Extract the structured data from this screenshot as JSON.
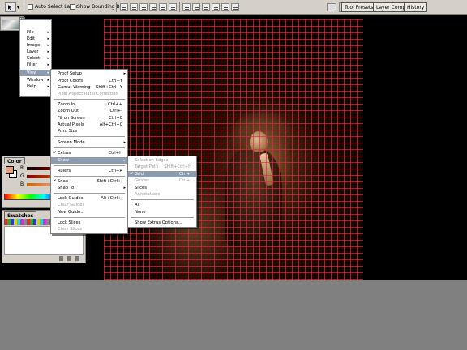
{
  "options_bar": {
    "auto_select_label": "Auto Select Layer",
    "bounding_box_label": "Show Bounding Box",
    "tabs": [
      "Tool Presets",
      "Layer Comps",
      "History"
    ]
  },
  "main_menu": {
    "items": [
      "File",
      "Edit",
      "Image",
      "Layer",
      "Select",
      "Filter",
      "View",
      "Window",
      "Help"
    ],
    "active": "View"
  },
  "view_menu": {
    "proof_setup": "Proof Setup",
    "proof_colors": "Proof Colors",
    "proof_colors_sc": "Ctrl+Y",
    "gamut_warning": "Gamut Warning",
    "gamut_warning_sc": "Shift+Ctrl+Y",
    "pixel_aspect": "Pixel Aspect Ratio Correction",
    "zoom_in": "Zoom In",
    "zoom_in_sc": "Ctrl++",
    "zoom_out": "Zoom Out",
    "zoom_out_sc": "Ctrl+-",
    "fit_on_screen": "Fit on Screen",
    "fit_on_screen_sc": "Ctrl+0",
    "actual_pixels": "Actual Pixels",
    "actual_pixels_sc": "Alt+Ctrl+0",
    "print_size": "Print Size",
    "screen_mode": "Screen Mode",
    "extras": "Extras",
    "extras_sc": "Ctrl+H",
    "show": "Show",
    "rulers": "Rulers",
    "rulers_sc": "Ctrl+R",
    "snap": "Snap",
    "snap_sc": "Shift+Ctrl+;",
    "snap_to": "Snap To",
    "lock_guides": "Lock Guides",
    "lock_guides_sc": "Alt+Ctrl+;",
    "clear_guides": "Clear Guides",
    "new_guide": "New Guide...",
    "lock_slices": "Lock Slices",
    "clear_slices": "Clear Slices"
  },
  "show_menu": {
    "selection_edges": "Selection Edges",
    "target_path": "Target Path",
    "target_path_sc": "Shift+Ctrl+H",
    "grid": "Grid",
    "grid_sc": "Ctrl+'",
    "guides": "Guides",
    "guides_sc": "Ctrl+;",
    "slices": "Slices",
    "annotations": "Annotations",
    "all": "All",
    "none": "None",
    "show_extras_options": "Show Extras Options..."
  },
  "color_palette": {
    "tab": "Color",
    "r": "R",
    "g": "G",
    "b": "B",
    "fg": "#e6a07d"
  },
  "swatches_palette": {
    "tab": "Swatches"
  }
}
